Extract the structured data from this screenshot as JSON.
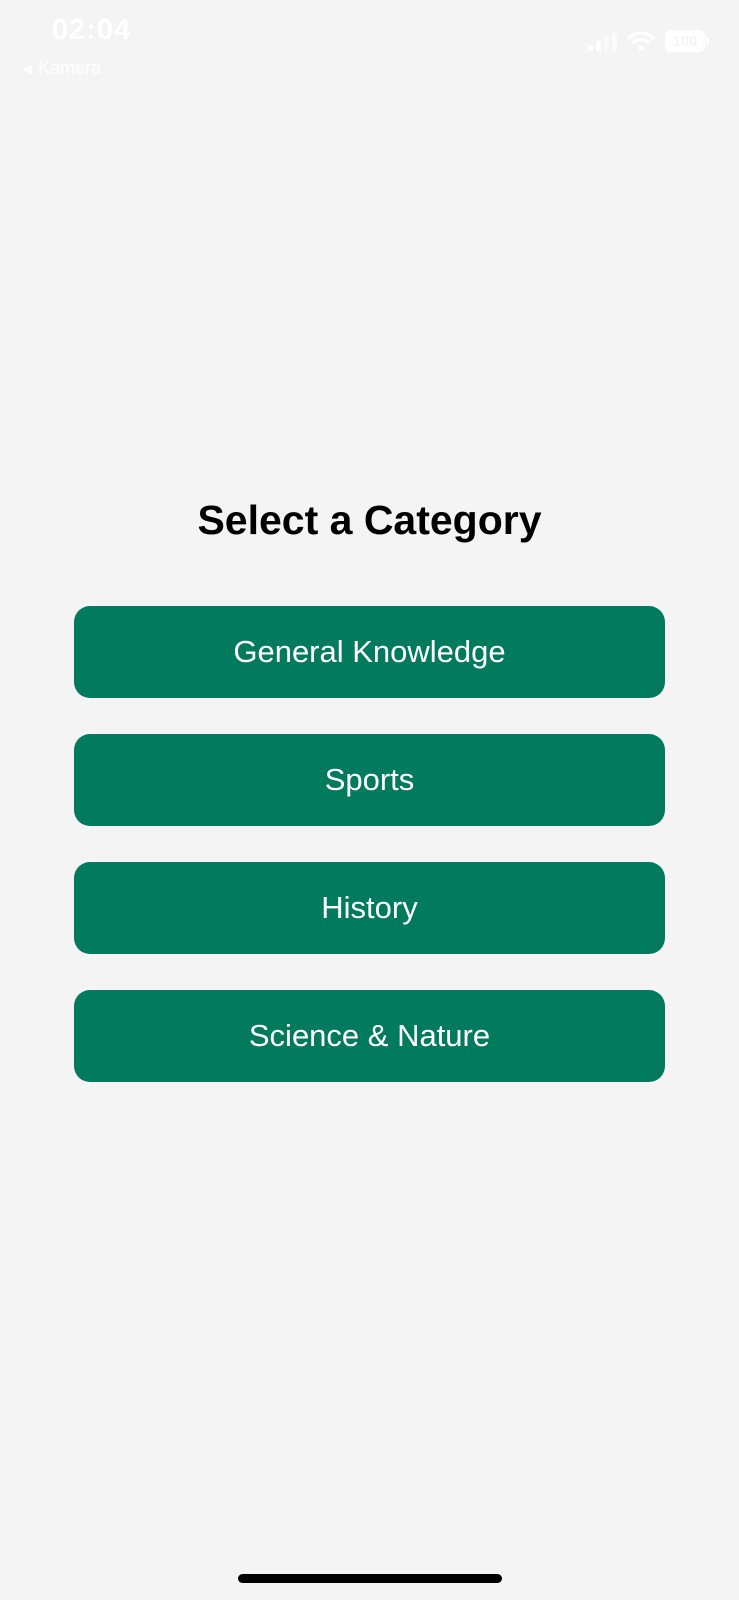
{
  "status_bar": {
    "time": "02:04",
    "back_label": "Kamera",
    "back_icon": "back-triangle-icon",
    "battery_level": "100",
    "icons": [
      "signal-icon",
      "wifi-icon",
      "battery-icon"
    ]
  },
  "main": {
    "title": "Select a Category",
    "categories": [
      {
        "label": "General Knowledge"
      },
      {
        "label": "Sports"
      },
      {
        "label": "History"
      },
      {
        "label": "Science & Nature"
      }
    ]
  },
  "colors": {
    "background": "#f4f4f4",
    "button": "#027a5e",
    "button_text": "#ffffff",
    "title": "#000000"
  }
}
